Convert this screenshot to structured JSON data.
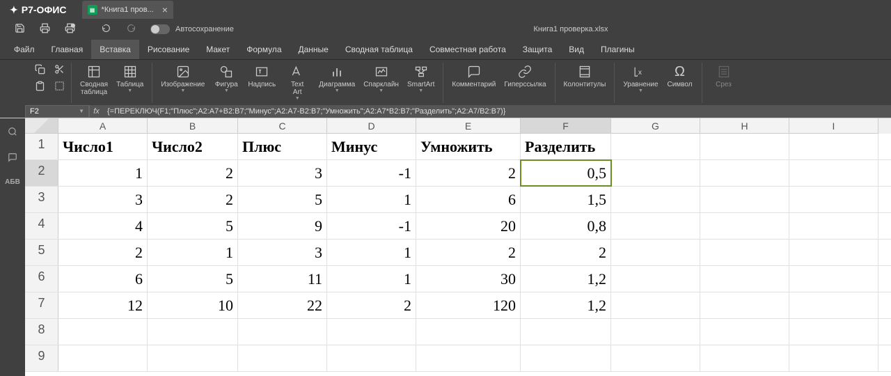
{
  "app": {
    "name": "Р7-ОФИС"
  },
  "tab": {
    "title": "*Книга1 пров...",
    "close": "×"
  },
  "quickbar": {
    "autosave": "Автосохранение",
    "doc_title": "Книга1 проверка.xlsx"
  },
  "menu": [
    "Файл",
    "Главная",
    "Вставка",
    "Рисование",
    "Макет",
    "Формула",
    "Данные",
    "Сводная таблица",
    "Совместная работа",
    "Защита",
    "Вид",
    "Плагины"
  ],
  "menu_active_index": 2,
  "ribbon": {
    "pivot": "Сводная\nтаблица",
    "table": "Таблица",
    "image": "Изображение",
    "shape": "Фигура",
    "textbox": "Надпись",
    "textart": "Text\nArt",
    "chart": "Диаграмма",
    "sparkline": "Спарклайн",
    "smartart": "SmartArt",
    "comment": "Комментарий",
    "hyperlink": "Гиперссылка",
    "headers": "Колонтитулы",
    "equation": "Уравнение",
    "symbol": "Символ",
    "slicer": "Срез"
  },
  "namebox": "F2",
  "formula": "{=ПЕРЕКЛЮЧ(F1;\"Плюс\";A2:A7+B2:B7;\"Минус\";A2:A7-B2:B7;\"Умножить\";A2:A7*B2:B7;\"Разделить\";A2:A7/B2:B7)}",
  "columns": [
    "A",
    "B",
    "C",
    "D",
    "E",
    "F",
    "G",
    "H",
    "I"
  ],
  "row_numbers": [
    "1",
    "2",
    "3",
    "4",
    "5",
    "6",
    "7",
    "8",
    "9"
  ],
  "headers": [
    "Число1",
    "Число2",
    "Плюс",
    "Минус",
    "Умножить",
    "Разделить"
  ],
  "data": [
    [
      "1",
      "2",
      "3",
      "-1",
      "2",
      "0,5"
    ],
    [
      "3",
      "2",
      "5",
      "1",
      "6",
      "1,5"
    ],
    [
      "4",
      "5",
      "9",
      "-1",
      "20",
      "0,8"
    ],
    [
      "2",
      "1",
      "3",
      "1",
      "2",
      "2"
    ],
    [
      "6",
      "5",
      "11",
      "1",
      "30",
      "1,2"
    ],
    [
      "12",
      "10",
      "22",
      "2",
      "120",
      "1,2"
    ]
  ],
  "selected": {
    "row": 2,
    "col": "F"
  }
}
